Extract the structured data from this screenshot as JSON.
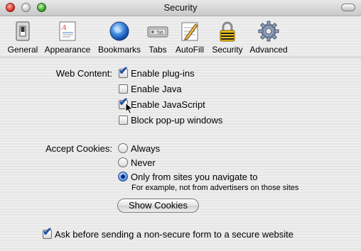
{
  "window": {
    "title": "Security"
  },
  "toolbar": {
    "items": [
      {
        "label": "General",
        "icon": "switch-icon"
      },
      {
        "label": "Appearance",
        "icon": "appearance-icon"
      },
      {
        "label": "Bookmarks",
        "icon": "globe-icon"
      },
      {
        "label": "Tabs",
        "icon": "tabs-icon"
      },
      {
        "label": "AutoFill",
        "icon": "pencil-form-icon"
      },
      {
        "label": "Security",
        "icon": "padlock-icon"
      },
      {
        "label": "Advanced",
        "icon": "gear-icon"
      }
    ],
    "tabs_icon_text": "Tab"
  },
  "web_content": {
    "label": "Web Content:",
    "options": [
      {
        "label": "Enable plug-ins",
        "checked": true
      },
      {
        "label": "Enable Java",
        "checked": false
      },
      {
        "label": "Enable JavaScript",
        "checked": true
      },
      {
        "label": "Block pop-up windows",
        "checked": false
      }
    ]
  },
  "cookies": {
    "label": "Accept Cookies:",
    "options": [
      {
        "label": "Always",
        "selected": false
      },
      {
        "label": "Never",
        "selected": false
      },
      {
        "label": "Only from sites you navigate to",
        "selected": true
      }
    ],
    "hint": "For example, not from advertisers on those sites",
    "show_button": "Show Cookies"
  },
  "footer": {
    "ask_label": "Ask before sending a non-secure form to a secure website",
    "ask_checked": true
  },
  "colors": {
    "check": "#1f4fa8",
    "radio_selected": "#2a62c9"
  }
}
